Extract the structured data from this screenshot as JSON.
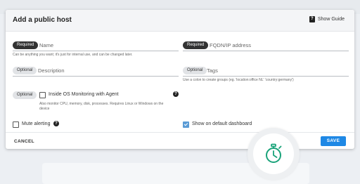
{
  "dialog": {
    "title": "Add a public host",
    "show_guide": "Show Guide",
    "guide_icon": "?"
  },
  "fields": {
    "name": {
      "pill": "Required",
      "label": "Name",
      "hint": "Can be anything you want; it's just for internal use, and can be changed later."
    },
    "fqdn": {
      "pill": "Required",
      "label": "FQDN/IP address"
    },
    "description": {
      "pill": "Optional",
      "label": "Description"
    },
    "tags": {
      "pill": "Optional",
      "label": "Tags",
      "hint": "Use a colon to create groups (eg. 'location:office NL' 'country:germany')"
    }
  },
  "os_monitoring": {
    "pill": "Optional",
    "label": "Inside OS Monitoring with Agent",
    "hint_line1": "Also monitor CPU, memory, disk, processes. Requires Linux or Windows on the",
    "hint_line2": "device",
    "checked": false,
    "help": "?"
  },
  "mute_alerting": {
    "label": "Mute alerting",
    "checked": false,
    "help": "?"
  },
  "show_dashboard": {
    "label": "Show on default dashboard",
    "checked": true
  },
  "footer": {
    "cancel": "CANCEL",
    "save": "SAVE"
  },
  "colors": {
    "primary": "#1e88e5",
    "accent_green": "#1aa37a",
    "pill_dark": "#333333"
  },
  "icons": [
    "help-icon",
    "stopwatch-icon"
  ]
}
